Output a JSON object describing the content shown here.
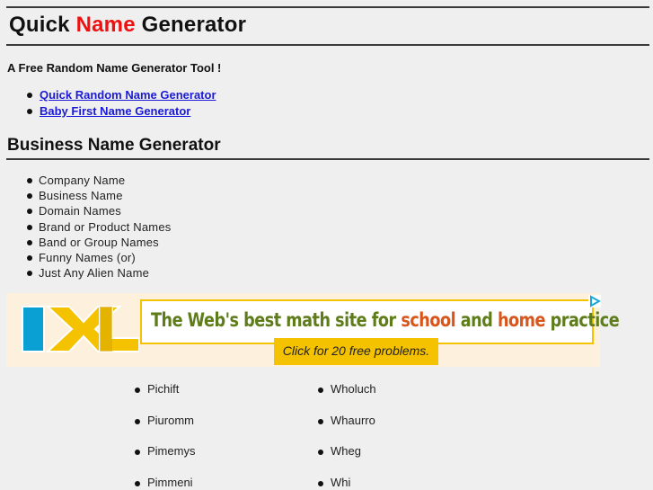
{
  "header": {
    "title_part1": "Quick",
    "title_accent": "Name",
    "title_part2": "Generator",
    "accent_color": "#ee1111"
  },
  "tagline": "A Free Random Name Generator Tool !",
  "links": [
    {
      "label": "Quick Random Name Generator"
    },
    {
      "label": "Baby First Name Generator"
    }
  ],
  "business_section": {
    "title": "Business Name Generator",
    "items": [
      "Company Name",
      "Business Name",
      "Domain Names",
      "Brand or Product Names",
      "Band or Group Names",
      "Funny Names (or)",
      "Just Any Alien Name"
    ]
  },
  "ad": {
    "logo_text": "IXL",
    "headline_part1": "The Web's best math site for",
    "headline_word1": "school",
    "headline_part2": "and",
    "headline_word2": "home",
    "headline_part3": "practice",
    "cta": "Click for 20 free problems.",
    "adchoices_icon": "adchoices-triangle-icon",
    "colors": {
      "green": "#5e7d1a",
      "orange": "#d8561b",
      "yellow": "#f5c200",
      "blue": "#0aa0d4"
    }
  },
  "generated_names": {
    "column1": [
      "Pichift",
      "Piuromm",
      "Pimemys",
      "Pimmeni"
    ],
    "column2": [
      "Wholuch",
      "Whaurro",
      "Wheg",
      "Whi"
    ]
  }
}
